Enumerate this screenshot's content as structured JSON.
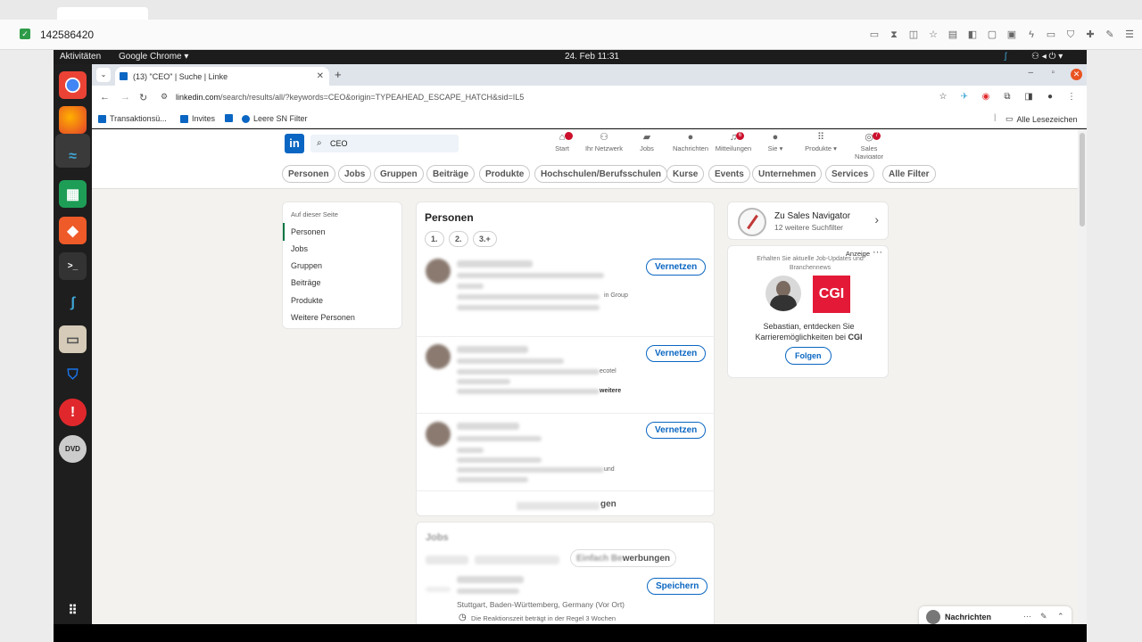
{
  "outer": {
    "counter": "142586420"
  },
  "gnome": {
    "activities": "Aktivitäten",
    "app_menu": "Google Chrome ▾",
    "datetime": "24. Feb  11:31"
  },
  "chrome": {
    "tab_title": "(13) \"CEO\" | Suche | Linke",
    "url_host": "linkedin.com",
    "url_path": "/search/results/all/?keywords=CEO&origin=TYPEAHEAD_ESCAPE_HATCH&sid=IL5",
    "bookmarks": [
      "Transaktionsü...",
      "Invites",
      "Leere SN Filter"
    ],
    "all_bookmarks": "Alle Lesezeichen"
  },
  "header": {
    "search_value": "CEO",
    "nav": [
      {
        "label": "Start",
        "icon": "home-icon"
      },
      {
        "label": "Ihr Netzwerk",
        "icon": "network-icon"
      },
      {
        "label": "Jobs",
        "icon": "jobs-icon"
      },
      {
        "label": "Nachrichten",
        "icon": "messaging-icon"
      },
      {
        "label": "Mitteilungen",
        "icon": "bell-icon",
        "badge": "6"
      },
      {
        "label": "Sie ▾",
        "icon": "avatar-icon"
      },
      {
        "label": "Produkte ▾",
        "icon": "grid-icon"
      },
      {
        "label": "Sales Navigator",
        "icon": "compass-icon",
        "badge": "7"
      }
    ]
  },
  "filters": [
    "Personen",
    "Jobs",
    "Gruppen",
    "Beiträge",
    "Produkte",
    "Hochschulen/Berufsschulen",
    "Kurse",
    "Events",
    "Unternehmen",
    "Services",
    "Alle Filter"
  ],
  "left_nav": {
    "heading": "Auf dieser Seite",
    "items": [
      "Personen",
      "Jobs",
      "Gruppen",
      "Beiträge",
      "Produkte",
      "Weitere Personen"
    ]
  },
  "people": {
    "title": "Personen",
    "degrees": [
      "1.",
      "2.",
      "3.+"
    ],
    "connect_label": "Vernetzen",
    "results": [
      {
        "frag1": "in Group"
      },
      {
        "frag1": "ecotel",
        "frag2": "weitere"
      },
      {
        "frag1": "und"
      }
    ],
    "see_all": "gen"
  },
  "jobs": {
    "title": "Jobs",
    "pill_frag": "werbungen",
    "location": "Stuttgart, Baden-Württemberg, Germany (Vor Ort)",
    "response": "Die Reaktionszeit beträgt in der Regel 3 Wochen",
    "save_label": "Speichern"
  },
  "sales_nav": {
    "title": "Zu Sales Navigator",
    "subtitle": "12 weitere Suchfilter"
  },
  "ad": {
    "label": "Anzeige",
    "subtitle": "Erhalten Sie aktuelle Job-Updates und Branchennews",
    "logo_text": "CGI",
    "text": "Sebastian, entdecken Sie Karrieremöglichkeiten bei",
    "company": "CGI",
    "follow_label": "Folgen"
  },
  "messaging": {
    "label": "Nachrichten"
  }
}
